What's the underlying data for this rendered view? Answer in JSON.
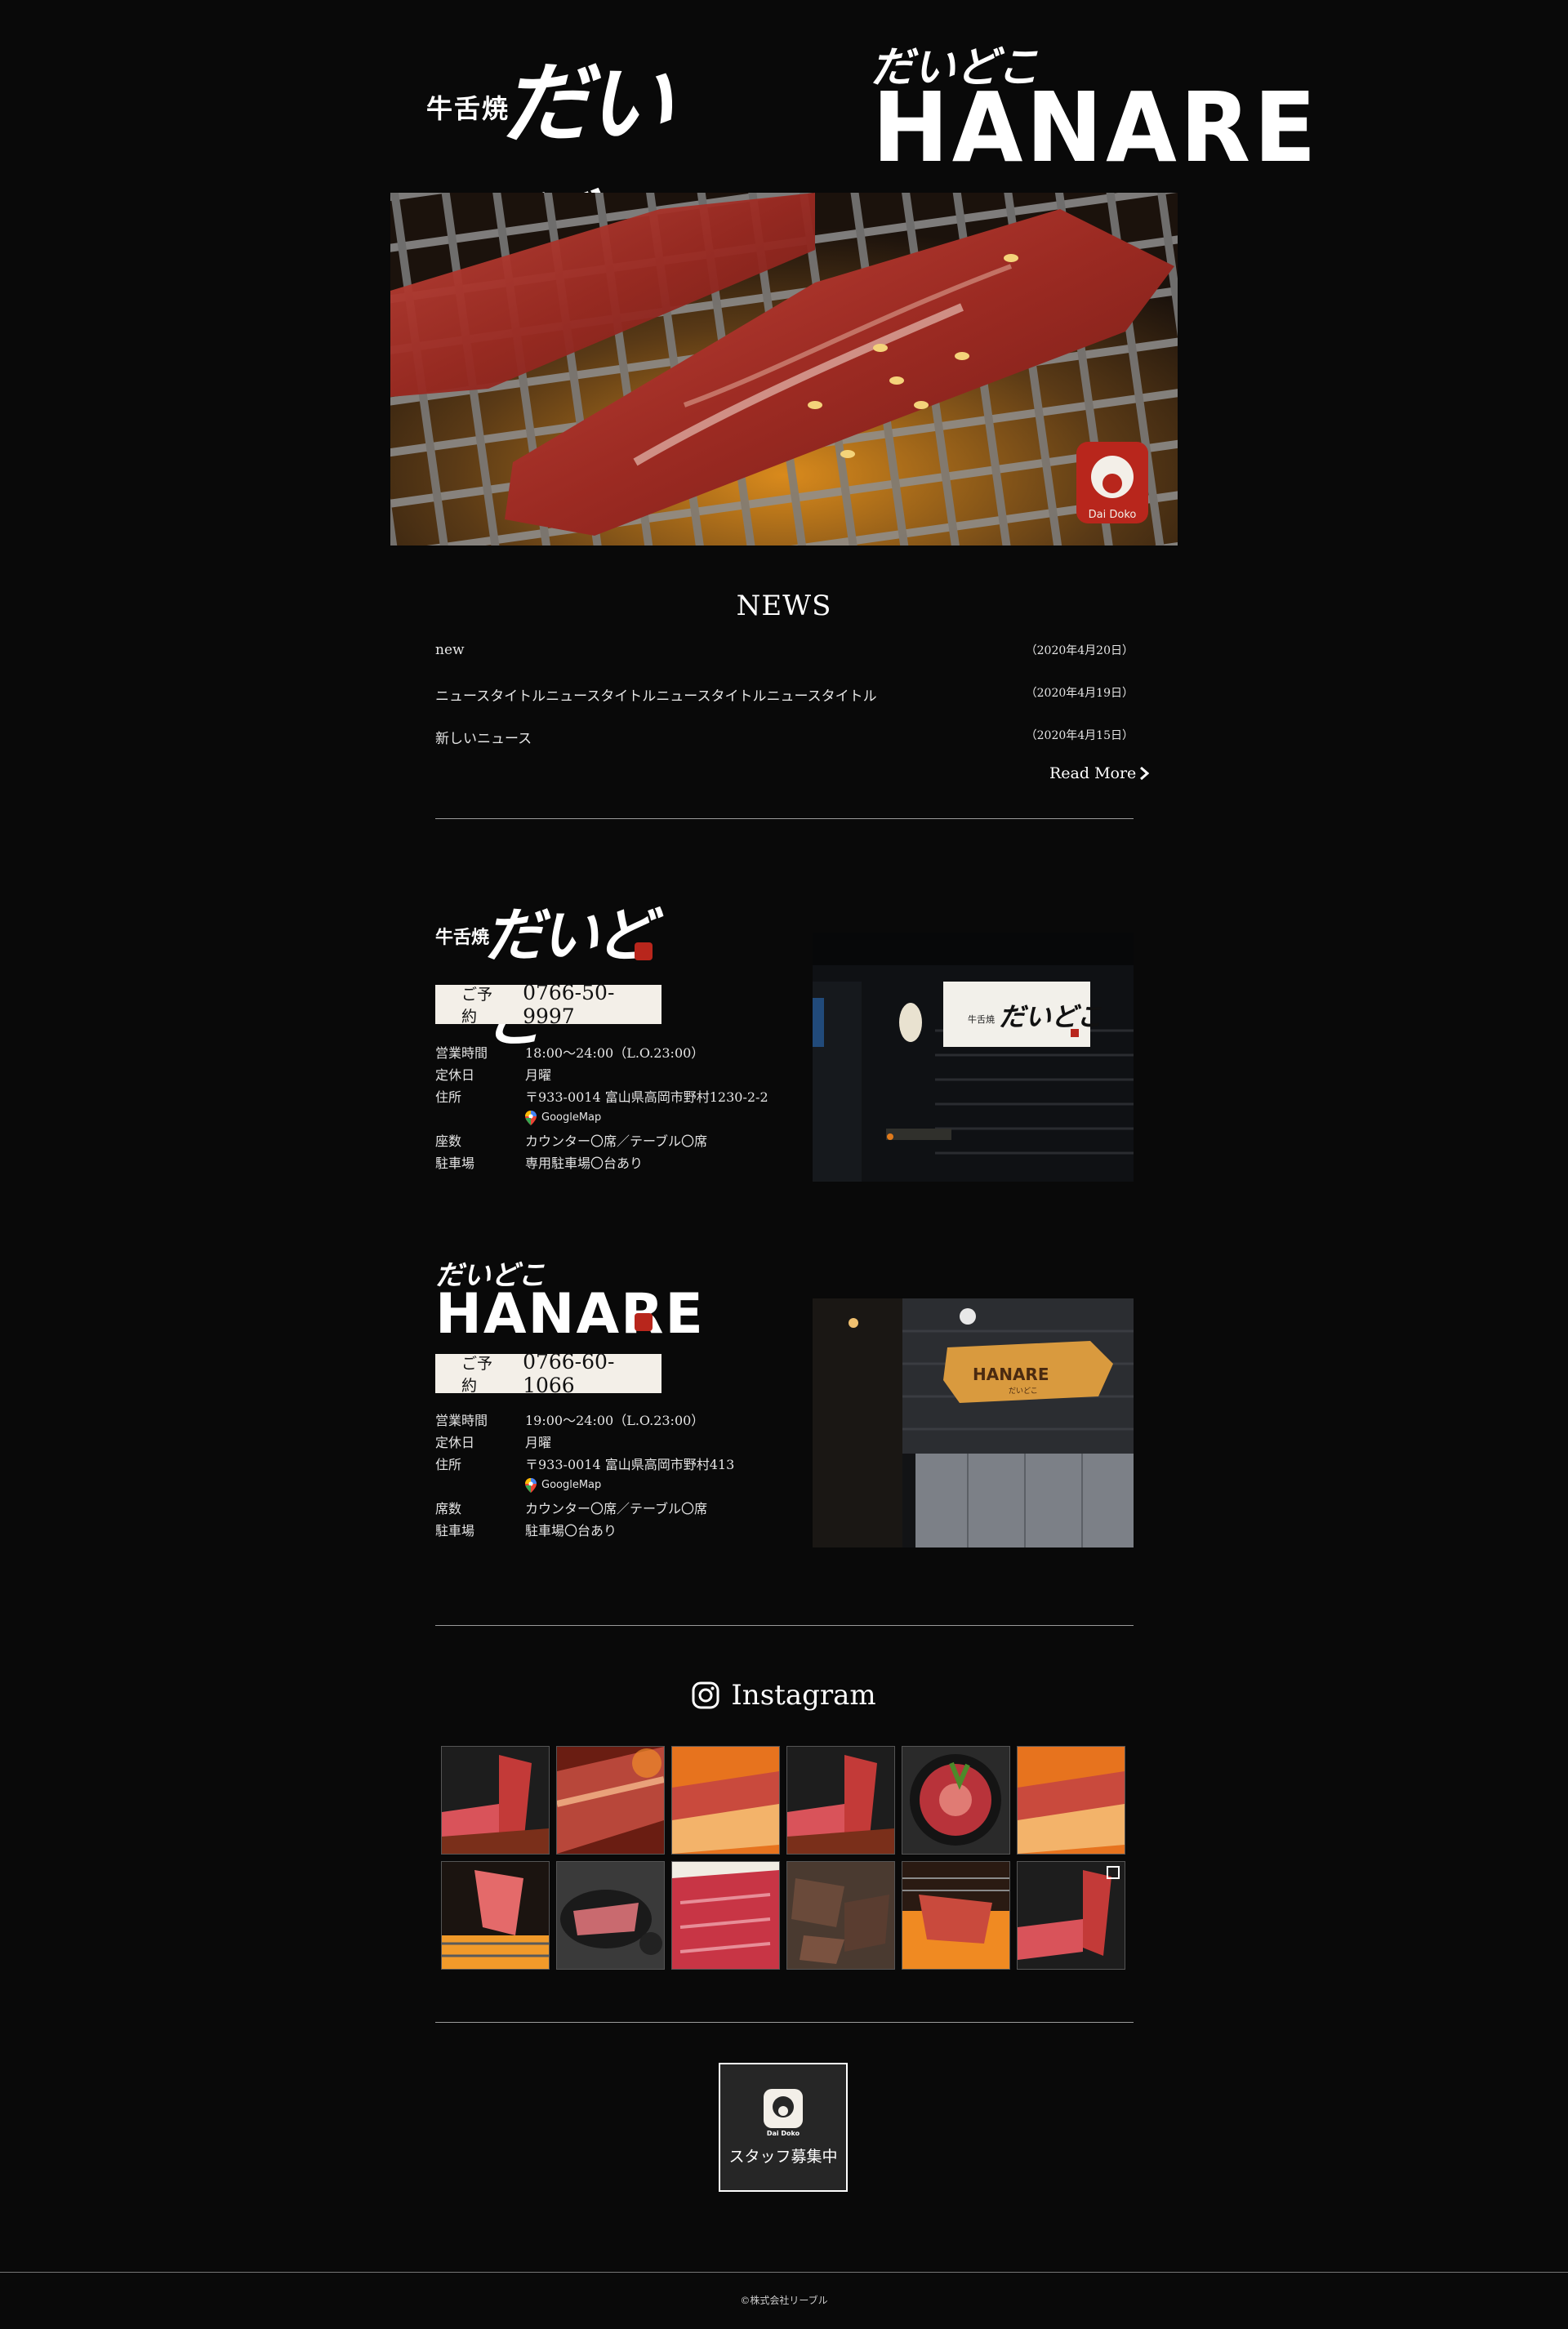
{
  "header": {
    "logo_left_small": "牛舌焼",
    "logo_left_main": "だいどこ",
    "logo_right_small": "だいどこ",
    "logo_right_main": "HANARE"
  },
  "hero": {
    "badge_text": "Dai Doko"
  },
  "news": {
    "title": "NEWS",
    "items": [
      {
        "title": "new",
        "date": "（2020年4月20日）"
      },
      {
        "title": "ニュースタイトルニュースタイトルニュースタイトルニュースタイトル",
        "date": "（2020年4月19日）"
      },
      {
        "title": "新しいニュース",
        "date": "（2020年4月15日）"
      }
    ],
    "read_more": "Read More"
  },
  "shops": [
    {
      "logo_small": "牛舌焼",
      "logo_main": "だいどこ",
      "reserve_label": "ご予約",
      "phone": "0766-50-9997",
      "rows": [
        {
          "key": "営業時間",
          "value": "18:00～24:00（L.O.23:00）"
        },
        {
          "key": "定休日",
          "value": "月曜"
        },
        {
          "key": "住所",
          "value": "〒933-0014 富山県高岡市野村1230-2-2"
        },
        {
          "key": "座数",
          "value": "カウンター〇席／テーブル〇席"
        },
        {
          "key": "駐車場",
          "value": "専用駐車場〇台あり"
        }
      ],
      "map_link": "GoogleMap",
      "sign_small": "牛舌焼",
      "sign_main": "だいどこ"
    },
    {
      "logo_small": "だいどこ",
      "logo_main": "HANARE",
      "reserve_label": "ご予約",
      "phone": "0766-60-1066",
      "rows": [
        {
          "key": "営業時間",
          "value": "19:00～24:00（L.O.23:00）"
        },
        {
          "key": "定休日",
          "value": "月曜"
        },
        {
          "key": "住所",
          "value": "〒933-0014 富山県高岡市野村413"
        },
        {
          "key": "席数",
          "value": "カウンター〇席／テーブル〇席"
        },
        {
          "key": "駐車場",
          "value": "駐車場〇台あり"
        }
      ],
      "map_link": "GoogleMap",
      "sign_main": "HANARE",
      "sign_small": "だいどこ"
    }
  ],
  "instagram": {
    "title": "Instagram"
  },
  "recruit": {
    "brand": "Dai Doko",
    "label": "スタッフ募集中"
  },
  "footer": {
    "copyright": "©株式会社リーブル"
  },
  "colors": {
    "background": "#090909",
    "reserve_bg": "#f3efe8",
    "seal_red": "#b8261c",
    "divider": "#9a9a9a"
  }
}
